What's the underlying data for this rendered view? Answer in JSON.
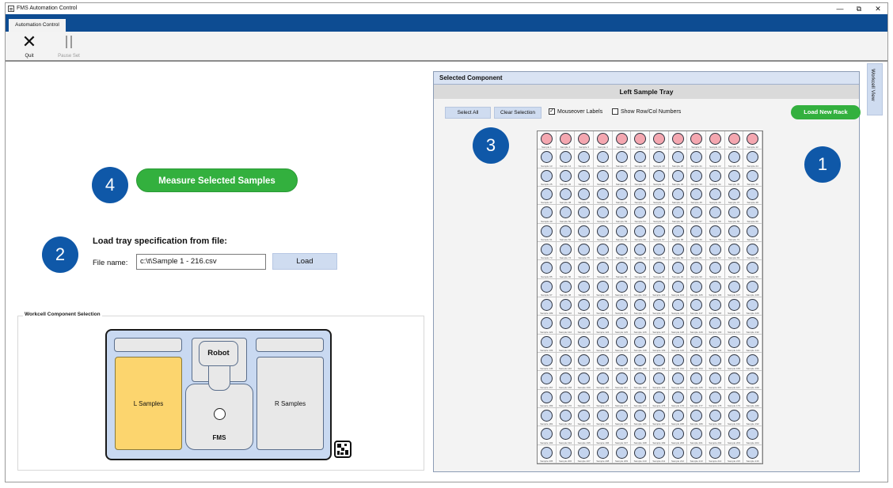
{
  "window": {
    "title": "FMS Automation Control",
    "minimize": "—",
    "restore": "⧉",
    "close": "✕"
  },
  "ribbon": {
    "active_tab": "Automation Control"
  },
  "toolbar": {
    "quit_label": "Quit",
    "pause_label": "Pause Set"
  },
  "badges": [
    "1",
    "2",
    "3",
    "4"
  ],
  "measure_button": "Measure Selected Samples",
  "load_section": {
    "title": "Load tray specification from file:",
    "file_label": "File name:",
    "file_value": "c:\\t\\Sample 1 - 216.csv",
    "load_button": "Load"
  },
  "workcell": {
    "group_title": "Workcell Component Selection",
    "robot": "Robot",
    "left_samples": "L Samples",
    "right_samples": "R Samples",
    "fms": "FMS",
    "selected_zone": "L Samples",
    "selected_color": "#fcd56e"
  },
  "side_tab": "Workcell View",
  "panel": {
    "header": "Selected Component",
    "tray_title": "Left Sample Tray",
    "select_all": "Select All",
    "clear_selection": "Clear Selection",
    "mouseover_labels": {
      "label": "Mouseover Labels",
      "checked": true
    },
    "show_rowcol": {
      "label": "Show Row/Col Numbers",
      "checked": false
    },
    "load_new_rack": "Load New Rack"
  },
  "tray": {
    "rows": 18,
    "cols": 12,
    "label_prefix": "Sample",
    "selected_rows": [
      1
    ],
    "selected_color": "#f4a7b0",
    "unselected_color": "#c4d4ee"
  },
  "colors": {
    "brand_blue": "#0d4c92",
    "badge_blue": "#0f58a8",
    "action_green": "#33b03e"
  }
}
